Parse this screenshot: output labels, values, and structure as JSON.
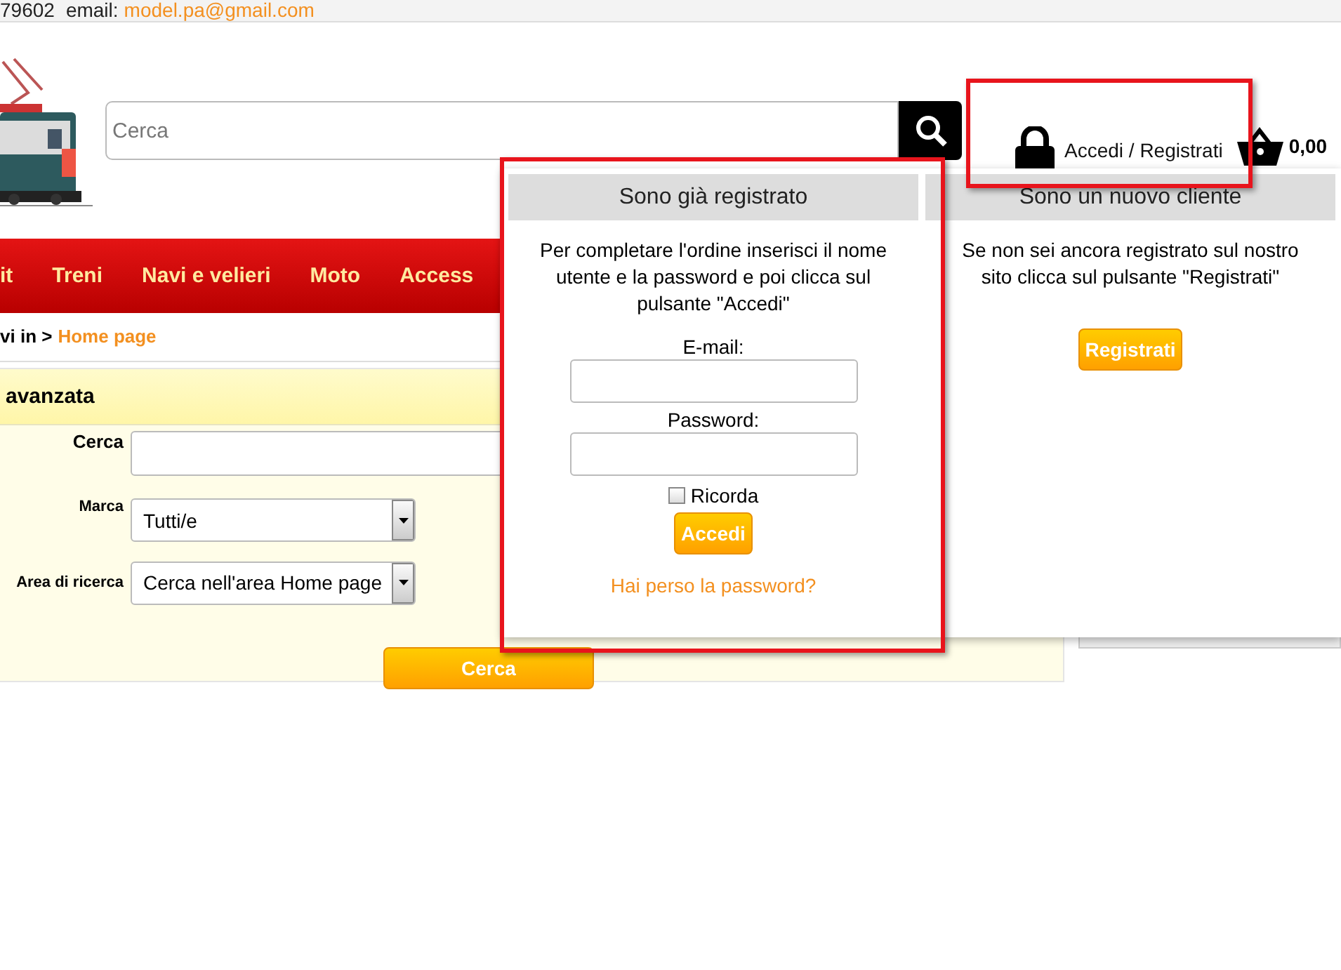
{
  "top_bar": {
    "phone": "79602",
    "email_label": "email:",
    "email": "model.pa@gmail.com"
  },
  "header": {
    "search": {
      "placeholder": "Cerca"
    },
    "login_link": "Accedi / Registrati",
    "cart_total": "0,00"
  },
  "nav": [
    "it",
    "Treni",
    "Navi e velieri",
    "Moto",
    "Access"
  ],
  "breadcrumb": {
    "prefix": "vi in >",
    "current": "Home page"
  },
  "advanced_search": {
    "title": "avanzata",
    "fields": [
      {
        "kind": "text",
        "label": "Cerca"
      },
      {
        "kind": "select",
        "label": "Marca",
        "value": "Tutti/e"
      },
      {
        "kind": "select",
        "label": "Area di ricerca",
        "value": "Cerca nell'area Home page"
      }
    ],
    "button": "Cerca"
  },
  "login_popup": {
    "existing": {
      "title": "Sono già registrato",
      "text": "Per completare l'ordine inserisci il nome utente e la password e poi clicca sul pulsante \"Accedi\"",
      "email_label": "E-mail:",
      "password_label": "Password:",
      "remember": {
        "label": "Ricorda",
        "checked": false
      },
      "button": "Accedi",
      "forgot_link": "Hai perso la password?"
    },
    "new": {
      "title": "Sono un nuovo cliente",
      "text": "Se non sei ancora registrato sul nostro sito clicca sul pulsante \"Registrati\"",
      "button": "Registrati"
    }
  }
}
